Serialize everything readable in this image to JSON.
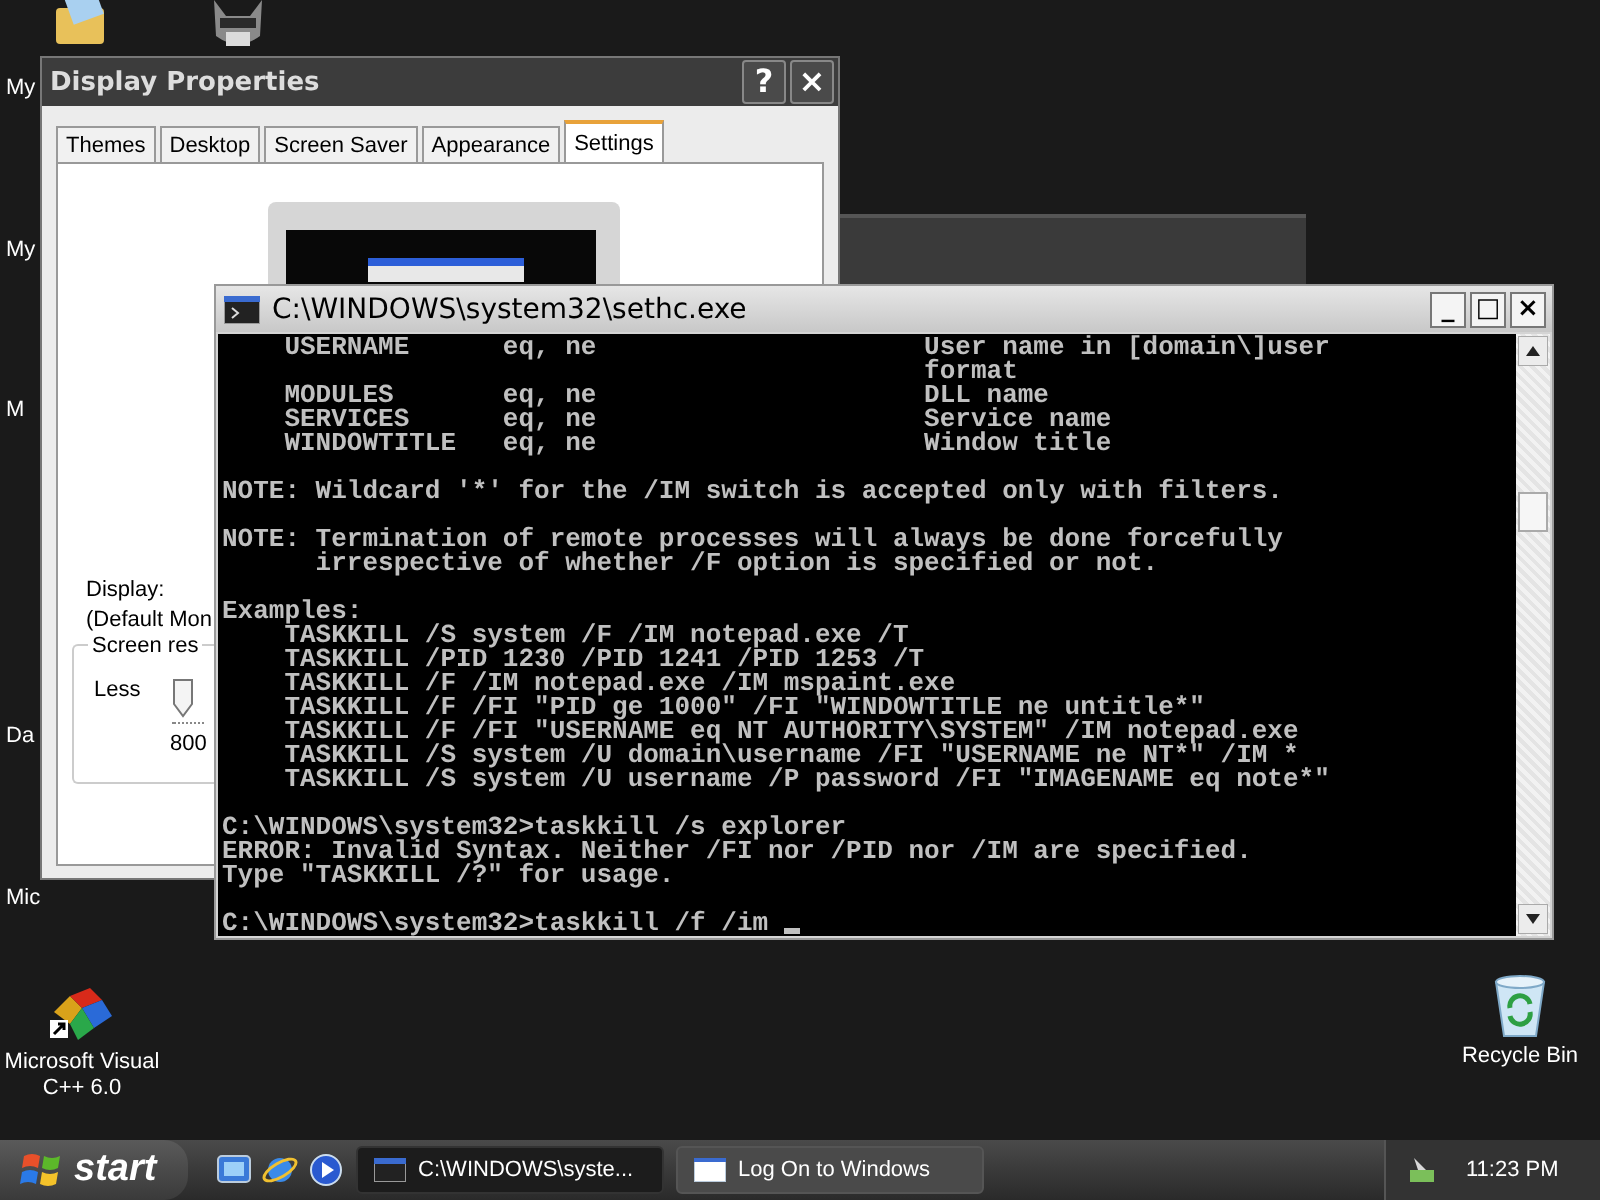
{
  "desktop_icons_left": [
    {
      "label": "My"
    },
    {
      "label": "My"
    },
    {
      "label": "M"
    },
    {
      "label": "Da"
    },
    {
      "label": "Mic"
    }
  ],
  "desktop_icons": [
    {
      "kind": "app",
      "label": "Microsoft Visual C++ 6.0"
    },
    {
      "kind": "recycle-bin",
      "label": "Recycle Bin"
    }
  ],
  "display_properties": {
    "title": "Display Properties",
    "help_button": "?",
    "close_button": "×",
    "tabs": [
      {
        "label": "Themes",
        "selected": false
      },
      {
        "label": "Desktop",
        "selected": false
      },
      {
        "label": "Screen Saver",
        "selected": false
      },
      {
        "label": "Appearance",
        "selected": false
      },
      {
        "label": "Settings",
        "selected": true
      }
    ],
    "display_label": "Display:",
    "display_value": "(Default Mon",
    "resolution_group": "Screen res",
    "slider_min": "Less",
    "level": 0,
    "resolution": "800"
  },
  "console": {
    "title": "C:\\WINDOWS\\system32\\sethc.exe",
    "minimize": "_",
    "maximize": "□",
    "close": "×",
    "lines": [
      {
        "text": "    USERNAME      eq, ne                     User name in [domain\\]user"
      },
      {
        "text": "                                             format"
      },
      {
        "text": "    MODULES       eq, ne                     DLL name"
      },
      {
        "text": "    SERVICES      eq, ne                     Service name"
      },
      {
        "text": "    WINDOWTITLE   eq, ne                     Window title"
      },
      {
        "text": "NOTE: Wildcard '*' for the /IM switch is accepted only with filters.",
        "gap_before": true
      },
      {
        "text": "NOTE: Termination of remote processes will always be done forcefully",
        "gap_before": true
      },
      {
        "text": "      irrespective of whether /F option is specified or not."
      },
      {
        "text": "Examples:",
        "gap_before": true
      },
      {
        "text": "    TASKKILL /S system /F /IM notepad.exe /T"
      },
      {
        "text": "    TASKKILL /PID 1230 /PID 1241 /PID 1253 /T"
      },
      {
        "text": "    TASKKILL /F /IM notepad.exe /IM mspaint.exe"
      },
      {
        "text": "    TASKKILL /F /FI \"PID ge 1000\" /FI \"WINDOWTITLE ne untitle*\""
      },
      {
        "text": "    TASKKILL /F /FI \"USERNAME eq NT AUTHORITY\\SYSTEM\" /IM notepad.exe"
      },
      {
        "text": "    TASKKILL /S system /U domain\\username /FI \"USERNAME ne NT*\" /IM *"
      },
      {
        "text": "    TASKKILL /S system /U username /P password /FI \"IMAGENAME eq note*\""
      },
      {
        "text": "C:\\WINDOWS\\system32>taskkill /s explorer",
        "gap_before": true
      },
      {
        "text": "ERROR: Invalid Syntax. Neither /FI nor /PID nor /IM are specified."
      },
      {
        "text": "Type \"TASKKILL /?\" for usage."
      },
      {
        "text": "C:\\WINDOWS\\system32>taskkill /f /im ",
        "gap_before": true,
        "cursor": true
      }
    ]
  },
  "taskbar": {
    "start_label": "start",
    "tasks": [
      {
        "label": "C:\\WINDOWS\\syste...",
        "kind": "console",
        "selected": true
      },
      {
        "label": "Log On to Windows",
        "kind": "window",
        "selected": false
      }
    ],
    "clock": "11:23 PM"
  }
}
